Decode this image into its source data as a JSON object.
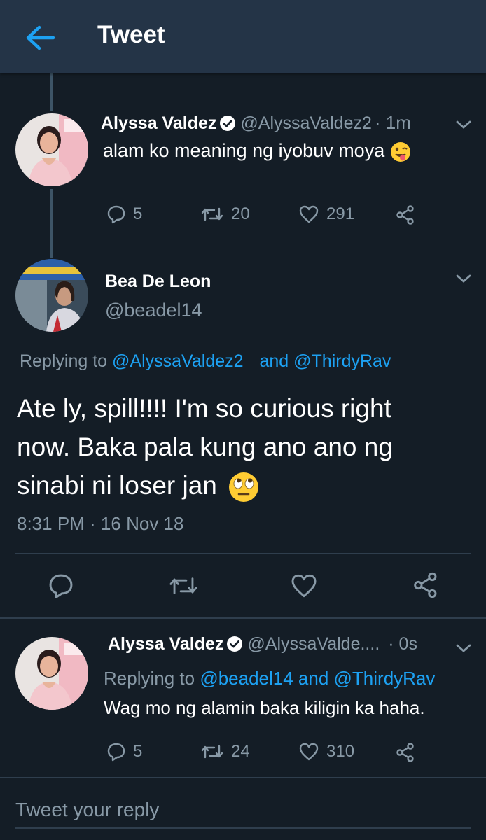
{
  "header": {
    "title": "Tweet",
    "back_icon": "arrow-left-icon"
  },
  "colors": {
    "accent": "#1da1f2",
    "background": "#141d26",
    "header": "#243447",
    "muted": "#8899a6"
  },
  "tweet1": {
    "name": "Alyssa Valdez",
    "handle": "@AlyssaValdez2",
    "time": "· 1m",
    "text": "alam ko meaning ng iyobuv moya",
    "emoji": "winking-face-with-tongue",
    "replies": "5",
    "retweets": "20",
    "likes": "291"
  },
  "main_tweet": {
    "name": "Bea De Leon",
    "handle": "@beadel14",
    "replying_prefix": "Replying to",
    "replying_to_1": "@AlyssaValdez2",
    "replying_to_2": "and @ThirdyRav",
    "text_line1": "Ate ly, spill!!!! I'm so curious right",
    "text_line2": "now. Baka pala kung ano ano ng",
    "text_line3": "sinabi ni loser jan",
    "emoji": "face-with-rolling-eyes",
    "timestamp": "8:31 PM · 16 Nov 18"
  },
  "tweet3": {
    "name": "Alyssa Valdez",
    "handle": "@AlyssaValde....",
    "time": "· 0s",
    "replying_prefix": "Replying to",
    "replying_to": "@beadel14 and @ThirdyRav",
    "text": "Wag mo ng alamin baka kiligin ka haha.",
    "replies": "5",
    "retweets": "24",
    "likes": "310"
  },
  "reply": {
    "placeholder": "Tweet your reply"
  }
}
